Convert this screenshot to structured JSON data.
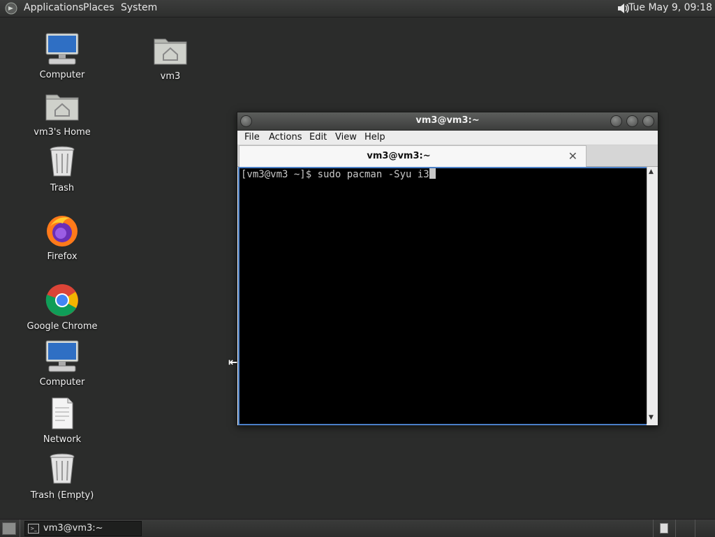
{
  "top_panel": {
    "menus": [
      "Applications",
      "Places",
      "System"
    ],
    "clock": "Tue May  9, 09:18"
  },
  "desktop_icons": [
    {
      "label": "Computer",
      "icon": "computer-icon"
    },
    {
      "label": "vm3's Home",
      "icon": "home-folder-icon"
    },
    {
      "label": "Trash",
      "icon": "trash-icon"
    },
    {
      "label": "Firefox",
      "icon": "firefox-icon"
    },
    {
      "label": "Google Chrome",
      "icon": "chrome-icon"
    },
    {
      "label": "Computer",
      "icon": "computer-icon"
    },
    {
      "label": "Network",
      "icon": "document-icon"
    },
    {
      "label": "Trash (Empty)",
      "icon": "trash-icon"
    },
    {
      "label": "vm3",
      "icon": "home-folder-icon"
    }
  ],
  "terminal_window": {
    "title": "vm3@vm3:~",
    "menu": [
      "File",
      "Actions",
      "Edit",
      "View",
      "Help"
    ],
    "tab_title": "vm3@vm3:~",
    "tab_close": "✕",
    "prompt_line": "[vm3@vm3 ~]$ sudo pacman -Syu i3"
  },
  "bottom_panel": {
    "task_label": "vm3@vm3:~"
  }
}
